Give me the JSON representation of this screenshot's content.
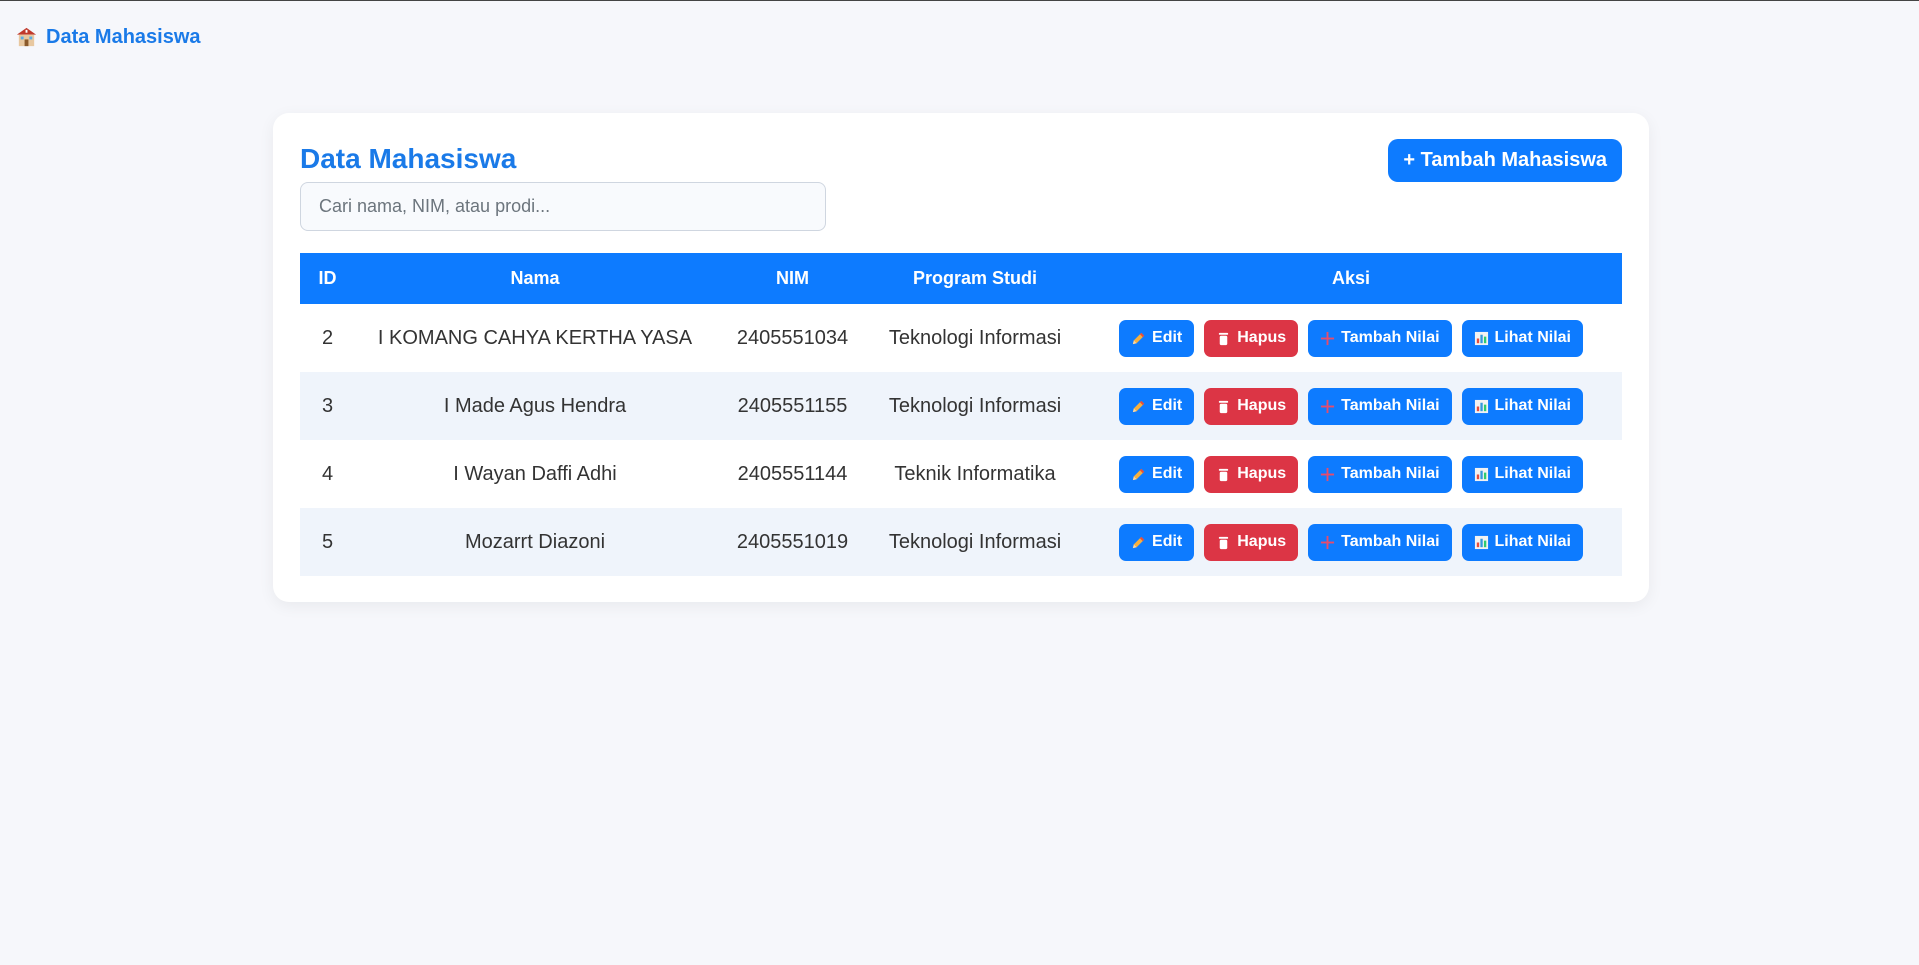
{
  "nav": {
    "brand_label": "Data Mahasiswa",
    "brand_icon": "school-icon"
  },
  "header": {
    "title": "Data Mahasiswa",
    "search_placeholder": "Cari nama, NIM, atau prodi...",
    "search_value": "",
    "add_label": "+ Tambah Mahasiswa"
  },
  "table": {
    "headers": {
      "id": "ID",
      "nama": "Nama",
      "nim": "NIM",
      "prodi": "Program Studi",
      "aksi": "Aksi"
    },
    "rows": [
      {
        "id": "2",
        "nama": "I KOMANG CAHYA KERTHA YASA",
        "nim": "2405551034",
        "prodi": "Teknologi Informasi"
      },
      {
        "id": "3",
        "nama": "I Made Agus Hendra",
        "nim": "2405551155",
        "prodi": "Teknologi Informasi"
      },
      {
        "id": "4",
        "nama": "I Wayan Daffi Adhi",
        "nim": "2405551144",
        "prodi": "Teknik Informatika"
      },
      {
        "id": "5",
        "nama": "Mozarrt Diazoni",
        "nim": "2405551019",
        "prodi": "Teknologi Informasi"
      }
    ],
    "actions": {
      "edit_label": "Edit",
      "hapus_label": "Hapus",
      "tambah_nilai_label": "Tambah Nilai",
      "lihat_nilai_label": "Lihat Nilai"
    }
  },
  "colors": {
    "primary": "#0d7bff",
    "danger": "#dc3545",
    "stripe": "#eff4fb",
    "background": "#f6f7fb"
  }
}
